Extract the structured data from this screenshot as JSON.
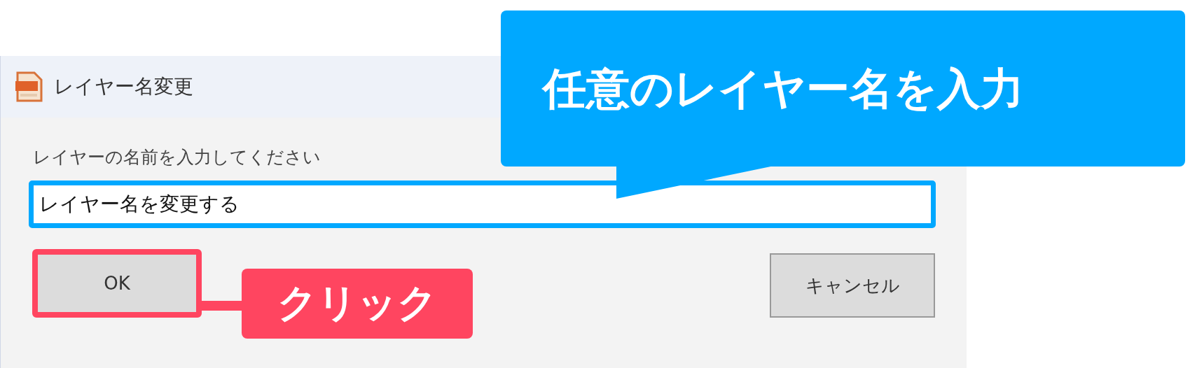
{
  "dialog": {
    "title": "レイヤー名変更",
    "prompt": "レイヤーの名前を入力してください",
    "input": {
      "value": "レイヤー名を変更する",
      "highlighted": true
    },
    "buttons": [
      {
        "label": "OK",
        "highlighted": true
      },
      {
        "label": "キャンセル",
        "highlighted": false
      }
    ]
  },
  "annotations": [
    {
      "kind": "callout",
      "text": "任意のレイヤー名を入力"
    },
    {
      "kind": "label",
      "text": "クリック"
    }
  ]
}
